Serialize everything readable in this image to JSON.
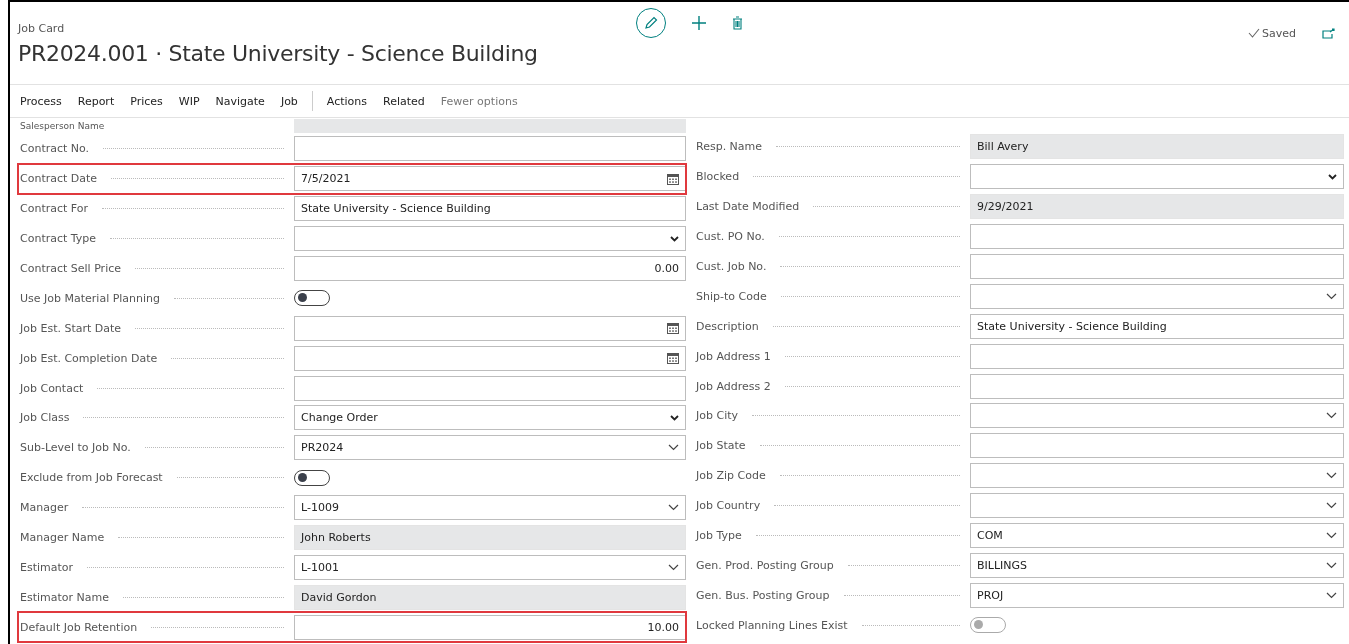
{
  "header": {
    "caption": "Job Card",
    "title": "PR2024.001 · State University - Science Building",
    "status": "Saved"
  },
  "menu": [
    {
      "label": "Process",
      "kind": "action"
    },
    {
      "label": "Report",
      "kind": "action"
    },
    {
      "label": "Prices",
      "kind": "action"
    },
    {
      "label": "WIP",
      "kind": "action"
    },
    {
      "label": "Navigate",
      "kind": "action"
    },
    {
      "label": "Job",
      "kind": "action"
    },
    {
      "label": "Actions",
      "kind": "action"
    },
    {
      "label": "Related",
      "kind": "action"
    },
    {
      "label": "Fewer options",
      "kind": "muted"
    }
  ],
  "left_fields": [
    {
      "label": "Salesperson Name",
      "kind": "partial"
    },
    {
      "label": "Contract No.",
      "kind": "text",
      "highlighted": false
    },
    {
      "label": "Contract Date",
      "kind": "date",
      "value": "7/5/2021",
      "highlighted": true
    },
    {
      "label": "Contract For",
      "kind": "text",
      "value": "State University - Science Building",
      "highlighted": false
    },
    {
      "label": "Contract Type",
      "kind": "select",
      "highlighted": false
    },
    {
      "label": "Contract Sell Price",
      "kind": "number",
      "value": "0.00",
      "highlighted": false
    },
    {
      "label": "Use Job Material Planning",
      "kind": "toggle",
      "on": false,
      "disabled": false,
      "highlighted": false
    },
    {
      "label": "Job Est. Start Date",
      "kind": "date",
      "highlighted": false
    },
    {
      "label": "Job Est. Completion Date",
      "kind": "date",
      "highlighted": false
    },
    {
      "label": "Job Contact",
      "kind": "text",
      "highlighted": false
    },
    {
      "label": "Job Class",
      "kind": "select",
      "value": "Change Order",
      "highlighted": false
    },
    {
      "label": "Sub-Level to Job No.",
      "kind": "lookup",
      "value": "PR2024",
      "highlighted": false
    },
    {
      "label": "Exclude from Job Forecast",
      "kind": "toggle",
      "on": false,
      "disabled": false,
      "highlighted": false
    },
    {
      "label": "Manager",
      "kind": "lookup",
      "value": "L-1009",
      "highlighted": false
    },
    {
      "label": "Manager Name",
      "kind": "readonly",
      "value": "John Roberts",
      "highlighted": false
    },
    {
      "label": "Estimator",
      "kind": "lookup",
      "value": "L-1001",
      "highlighted": false
    },
    {
      "label": "Estimator Name",
      "kind": "readonly",
      "value": "David Gordon",
      "highlighted": false
    },
    {
      "label": "Default Job Retention",
      "kind": "number",
      "value": "10.00",
      "highlighted": true
    }
  ],
  "right_fields": [
    {
      "label": "Resp. Name",
      "kind": "readonly",
      "value": "Bill Avery",
      "highlighted": false
    },
    {
      "label": "Blocked",
      "kind": "select",
      "highlighted": false
    },
    {
      "label": "Last Date Modified",
      "kind": "readonly",
      "value": "9/29/2021",
      "highlighted": false
    },
    {
      "label": "Cust. PO No.",
      "kind": "text",
      "highlighted": false
    },
    {
      "label": "Cust. Job No.",
      "kind": "text",
      "highlighted": false
    },
    {
      "label": "Ship-to Code",
      "kind": "lookup",
      "highlighted": false
    },
    {
      "label": "Description",
      "kind": "text",
      "value": "State University - Science Building",
      "highlighted": false
    },
    {
      "label": "Job Address 1",
      "kind": "text",
      "highlighted": false
    },
    {
      "label": "Job Address 2",
      "kind": "text",
      "highlighted": false
    },
    {
      "label": "Job City",
      "kind": "lookup",
      "highlighted": false
    },
    {
      "label": "Job State",
      "kind": "text",
      "highlighted": false
    },
    {
      "label": "Job Zip Code",
      "kind": "lookup",
      "highlighted": false
    },
    {
      "label": "Job Country",
      "kind": "lookup",
      "highlighted": false
    },
    {
      "label": "Job Type",
      "kind": "lookup",
      "value": "COM",
      "highlighted": false
    },
    {
      "label": "Gen. Prod. Posting Group",
      "kind": "lookup",
      "value": "BILLINGS",
      "highlighted": false
    },
    {
      "label": "Gen. Bus. Posting Group",
      "kind": "lookup",
      "value": "PROJ",
      "highlighted": false
    },
    {
      "label": "Locked Planning Lines Exist",
      "kind": "toggle",
      "on": false,
      "disabled": true,
      "highlighted": false
    }
  ]
}
